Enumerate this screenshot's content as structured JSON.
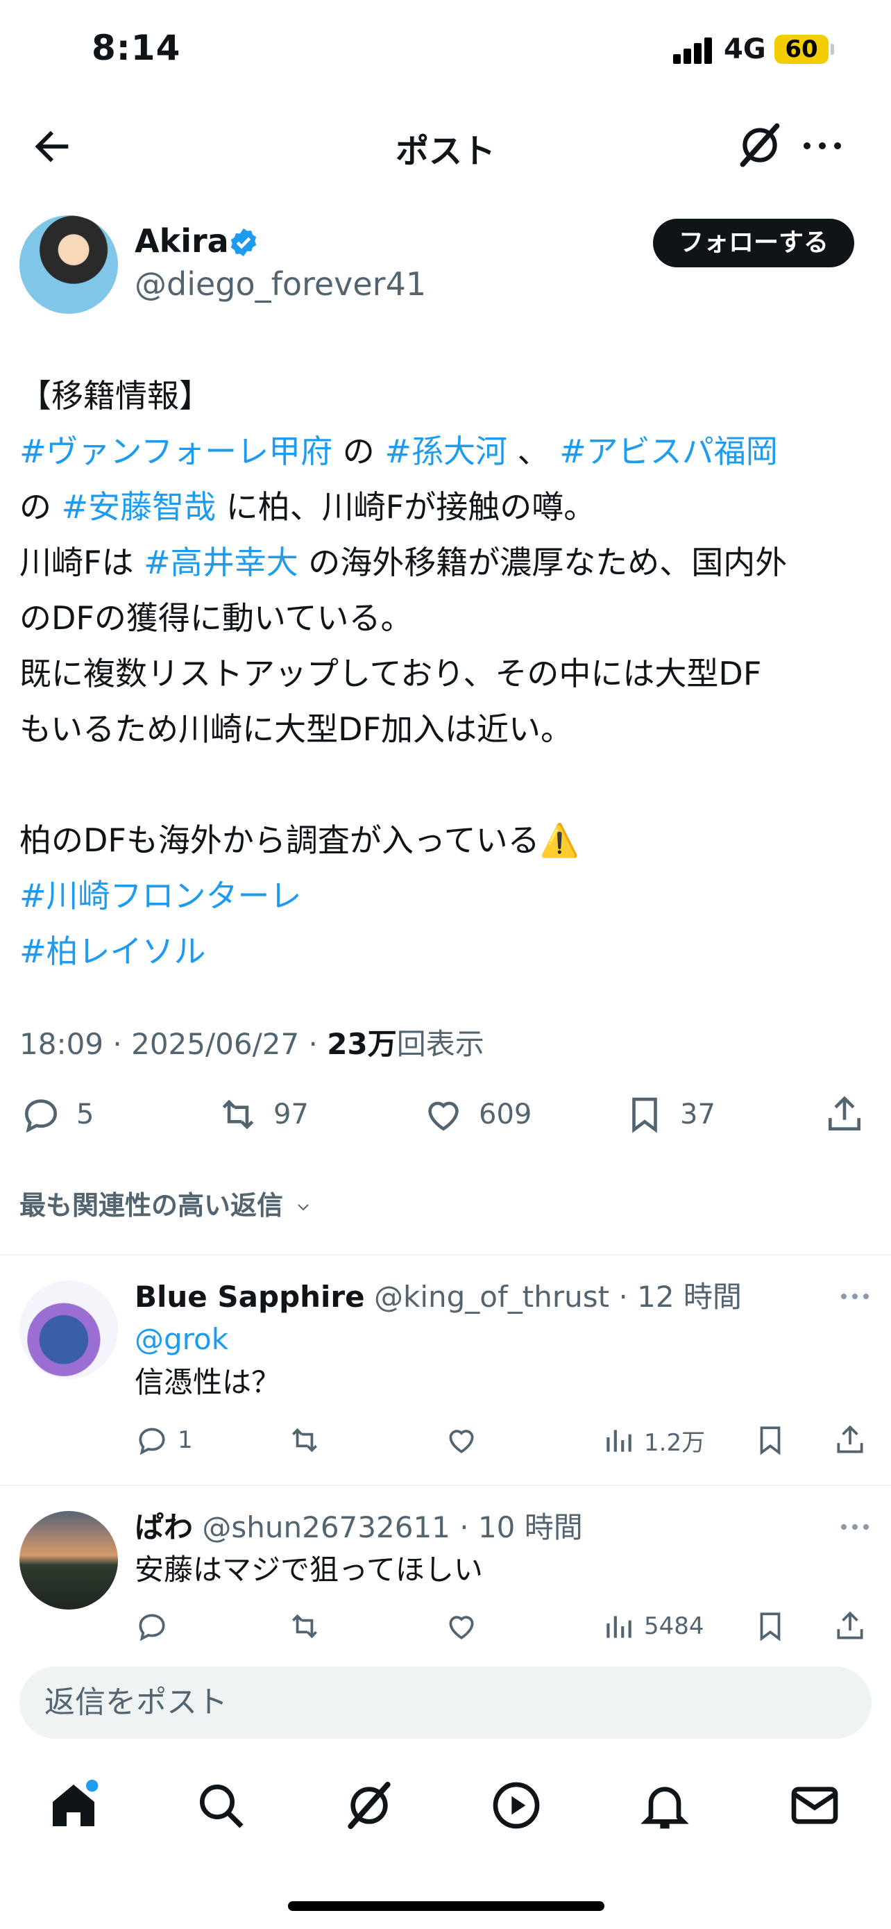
{
  "status_bar": {
    "time": "8:14",
    "network": "4G",
    "battery": "60"
  },
  "header": {
    "title": "ポスト"
  },
  "tweet": {
    "author_name": "Akira",
    "author_handle": "@diego_forever41",
    "follow_label": "フォローする",
    "body": {
      "l1": "【移籍情報】",
      "l2": [
        {
          "t": "#ヴァンフォーレ甲府",
          "tag": true
        },
        {
          "t": " の ",
          "tag": false
        },
        {
          "t": "#孫大河",
          "tag": true
        },
        {
          "t": " 、 ",
          "tag": false
        },
        {
          "t": "#アビスパ福岡",
          "tag": true
        }
      ],
      "l3": [
        {
          "t": "の ",
          "tag": false
        },
        {
          "t": "#安藤智哉",
          "tag": true
        },
        {
          "t": " に柏、川崎Fが接触の噂。",
          "tag": false
        }
      ],
      "l4": [
        {
          "t": "川崎Fは ",
          "tag": false
        },
        {
          "t": "#高井幸大",
          "tag": true
        },
        {
          "t": " の海外移籍が濃厚なため、国内外",
          "tag": false
        }
      ],
      "l5": "のDFの獲得に動いている。",
      "l6": "既に複数リストアップしており、その中には大型DF",
      "l7": "もいるため川崎に大型DF加入は近い。",
      "l8": "柏のDFも海外から調査が入っている⚠️",
      "l9": "#川崎フロンターレ",
      "l10": "#柏レイソル"
    },
    "meta": {
      "time": "18:09",
      "date": "2025/06/27",
      "views": "23万",
      "views_label": "回表示"
    },
    "stats": {
      "replies": "5",
      "reposts": "97",
      "likes": "609",
      "bookmarks": "37"
    }
  },
  "sort_label": "最も関連性の高い返信",
  "replies": [
    {
      "name": "Blue Sapphire",
      "handle": "@king_of_thrust",
      "time": "· 12 時間",
      "mention": "@grok",
      "text": "信憑性は？",
      "replies": "1",
      "views": "1.2万"
    },
    {
      "name": "ぱわ",
      "handle": "@shun26732611",
      "time": "· 10 時間",
      "text": "安藤はマジで狙ってほしい",
      "views": "5484"
    }
  ],
  "compose_placeholder": "返信をポスト",
  "colors": {
    "accent": "#1d9bf0",
    "text": "#0f1419",
    "muted": "#536471",
    "battery": "#f2cd00"
  },
  "icons": [
    "back-arrow-icon",
    "grok-icon",
    "more-icon",
    "verified-badge-icon",
    "reply-icon",
    "repost-icon",
    "like-icon",
    "bookmark-icon",
    "share-icon",
    "views-icon",
    "home-icon",
    "search-icon",
    "grok-tab-icon",
    "video-icon",
    "bell-icon",
    "mail-icon"
  ]
}
